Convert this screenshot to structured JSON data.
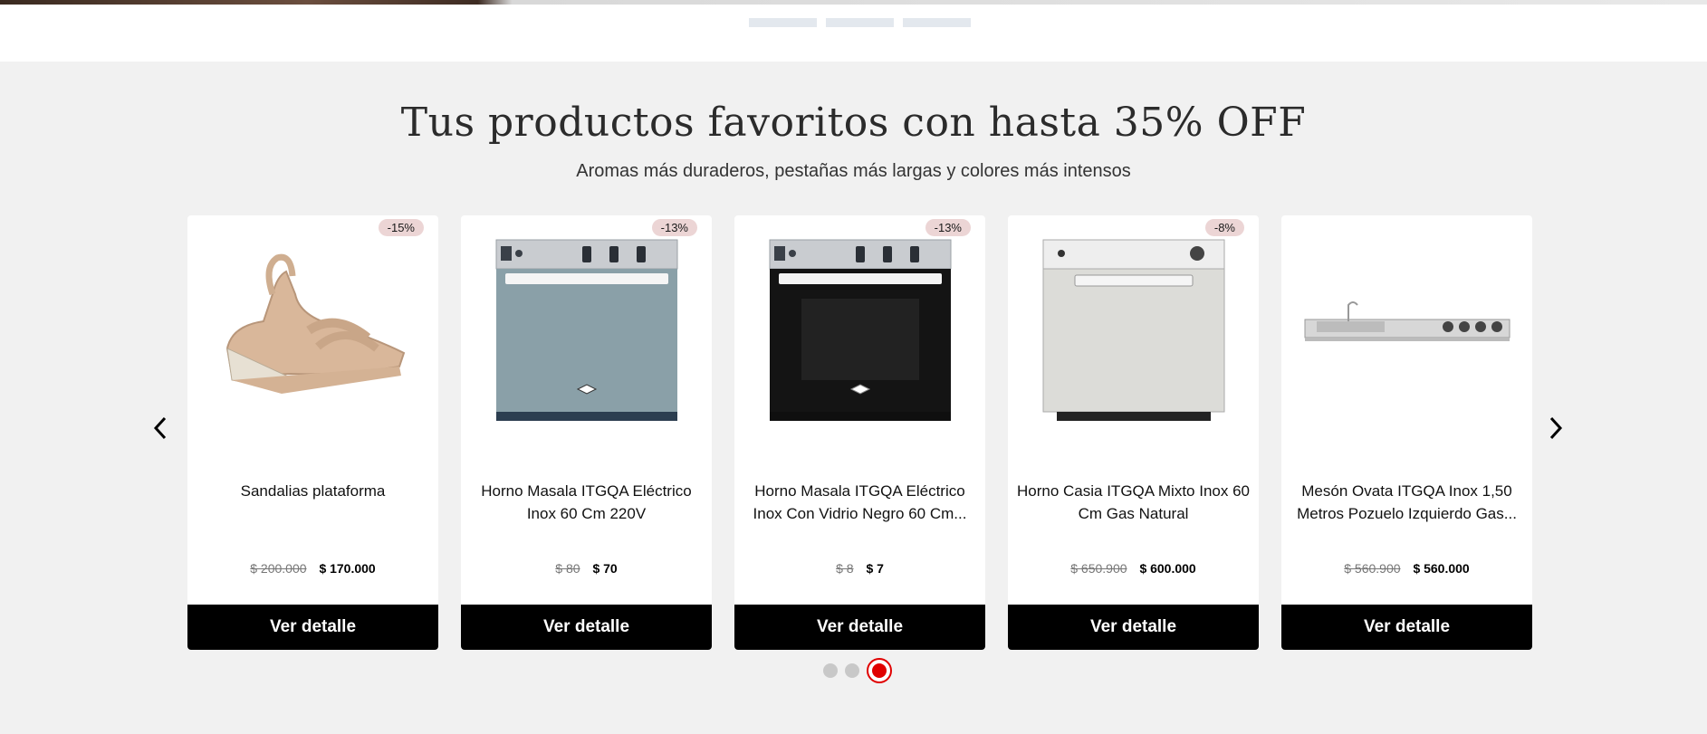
{
  "hero": {
    "dots": [
      "slide-1",
      "slide-2",
      "slide-3"
    ]
  },
  "section": {
    "title": "Tus productos favoritos con hasta 35% OFF",
    "subtitle": "Aromas más duraderos, pestañas más largas y colores más intensos"
  },
  "products": [
    {
      "badge": "-15%",
      "name": "Sandalias plataforma",
      "old_price": "$ 200.000",
      "new_price": "$ 170.000",
      "button": "Ver detalle",
      "image": "sandal-image"
    },
    {
      "badge": "-13%",
      "name": "Horno Masala ITGQA Eléctrico Inox 60 Cm 220V",
      "old_price": "$ 80",
      "new_price": "$ 70",
      "button": "Ver detalle",
      "image": "oven-glass-image"
    },
    {
      "badge": "-13%",
      "name": "Horno Masala ITGQA Eléctrico Inox Con Vidrio Negro 60 Cm...",
      "old_price": "$ 8",
      "new_price": "$ 7",
      "button": "Ver detalle",
      "image": "oven-black-image"
    },
    {
      "badge": "-8%",
      "name": "Horno Casia ITGQA Mixto Inox 60 Cm Gas Natural",
      "old_price": "$ 650.900",
      "new_price": "$ 600.000",
      "button": "Ver detalle",
      "image": "oven-white-image"
    },
    {
      "badge": "",
      "name": "Mesón Ovata ITGQA Inox 1,50 Metros Pozuelo Izquierdo Gas...",
      "old_price": "$ 560.900",
      "new_price": "$ 560.000",
      "button": "Ver detalle",
      "image": "countertop-image"
    }
  ],
  "carousel": {
    "pages": 3,
    "active_page": 3
  },
  "colors": {
    "accent": "#e00000",
    "button_bg": "#000000",
    "badge_bg": "#ecd5d5",
    "section_bg": "#f1f1f1"
  }
}
